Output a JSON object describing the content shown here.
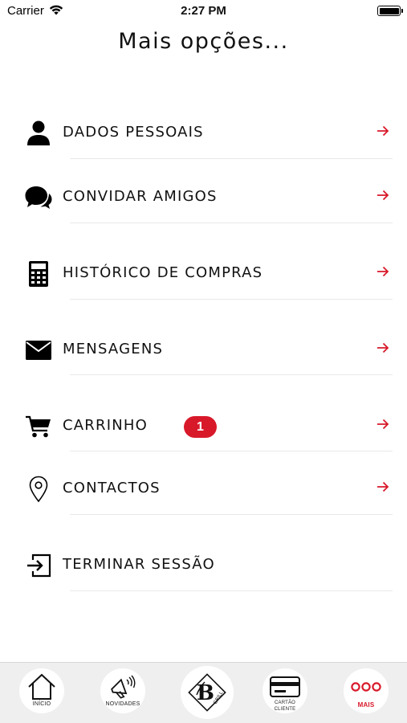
{
  "status_bar": {
    "carrier": "Carrier",
    "time": "2:27 PM"
  },
  "header": {
    "title": "Mais opções..."
  },
  "menu": [
    {
      "label": "DADOS PESSOAIS",
      "icon": "person-icon"
    },
    {
      "label": "CONVIDAR AMIGOS",
      "icon": "chat-bubbles-icon"
    },
    {
      "label": "HISTÓRICO DE COMPRAS",
      "icon": "calculator-icon"
    },
    {
      "label": "MENSAGENS",
      "icon": "envelope-icon"
    },
    {
      "label": "CARRINHO",
      "icon": "cart-icon",
      "badge": "1"
    },
    {
      "label": "CONTACTOS",
      "icon": "location-pin-icon"
    },
    {
      "label": "TERMINAR SESSÃO",
      "icon": "logout-icon"
    }
  ],
  "tabbar": {
    "items": [
      {
        "label": "INÍCIO",
        "icon": "home-icon"
      },
      {
        "label": "NOVIDADES",
        "icon": "megaphone-icon"
      },
      {
        "label": "",
        "icon": "brand-logo-icon",
        "logo_text": "B",
        "logo_subtext": "GRILL"
      },
      {
        "label": "CARTÃO CLIENTE",
        "label_line1": "CARTÃO",
        "label_line2": "CLIENTE",
        "icon": "card-icon"
      },
      {
        "label": "MAIS",
        "icon": "more-dots-icon",
        "active": true
      }
    ]
  },
  "colors": {
    "accent": "#d8192a",
    "text": "#111111",
    "divider": "#e9e9e9",
    "tabbar_bg": "#efefef"
  }
}
